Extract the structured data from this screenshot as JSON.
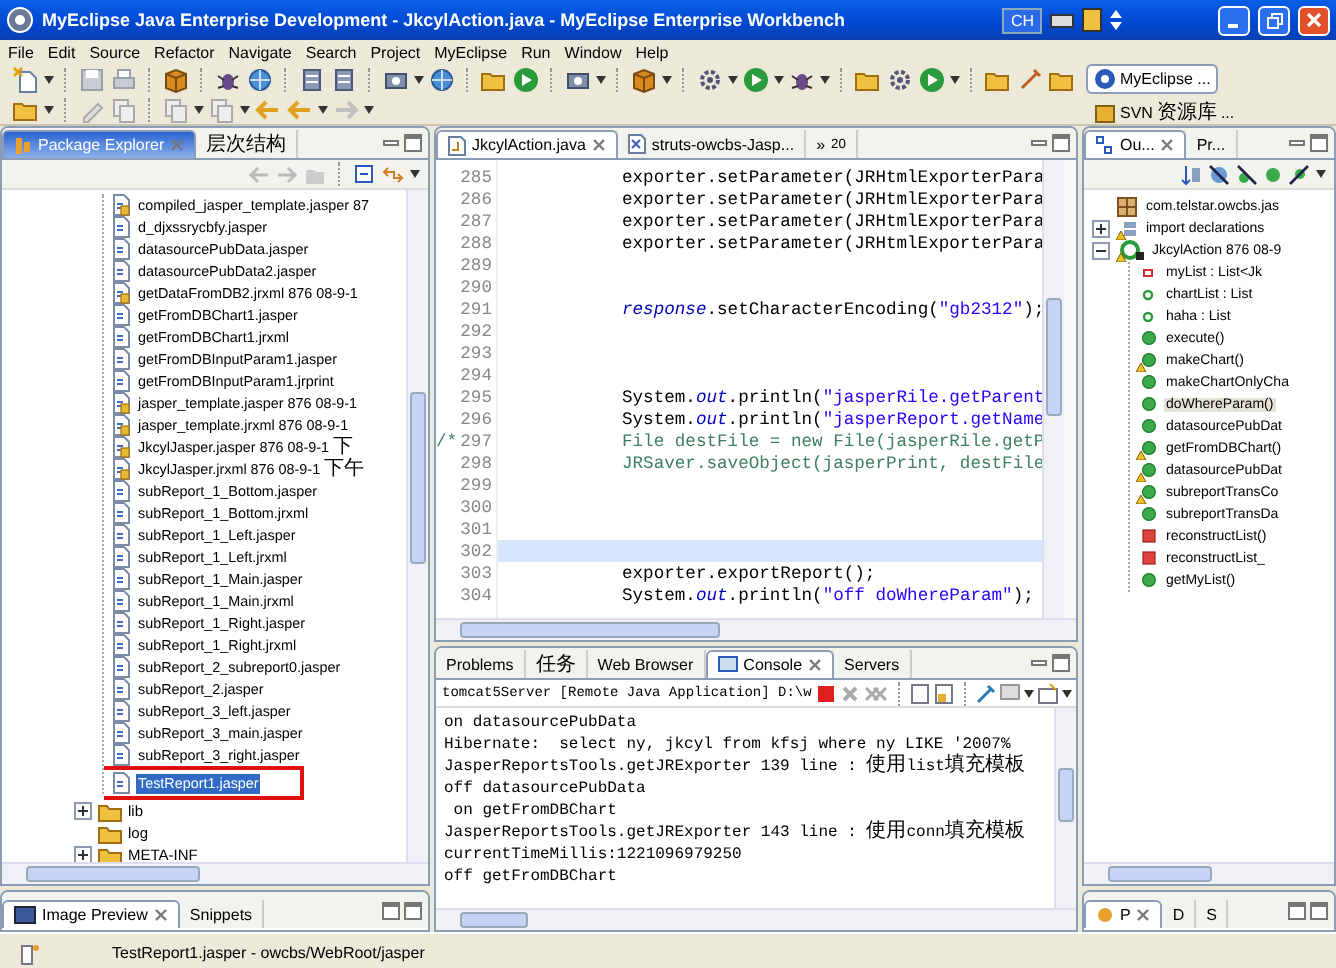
{
  "window": {
    "title": "MyEclipse Java Enterprise Development - JkcylAction.java - MyEclipse Enterprise Workbench",
    "language": "CH"
  },
  "menu": [
    "File",
    "Edit",
    "Source",
    "Refactor",
    "Navigate",
    "Search",
    "Project",
    "MyEclipse",
    "Run",
    "Window",
    "Help"
  ],
  "perspectives": [
    {
      "label": "MyEclipse ...",
      "selected": true
    },
    {
      "label": "SVN 资源库...",
      "selected": false
    }
  ],
  "explorer": {
    "tabs": [
      {
        "label": "Package Explorer",
        "selected": true
      },
      {
        "label": "层次结构",
        "selected": false
      }
    ],
    "files": [
      {
        "name": "compiled_jasper_template.jasper 87",
        "locked": true,
        "selected": false
      },
      {
        "name": "d_djxssrycbfy.jasper",
        "locked": false,
        "selected": false
      },
      {
        "name": "datasourcePubData.jasper",
        "locked": false,
        "selected": false
      },
      {
        "name": "datasourcePubData2.jasper",
        "locked": false,
        "selected": false
      },
      {
        "name": "getDataFromDB2.jrxml 876  08-9-1",
        "locked": true,
        "selected": false
      },
      {
        "name": "getFromDBChart1.jasper",
        "locked": false,
        "selected": false
      },
      {
        "name": "getFromDBChart1.jrxml",
        "locked": false,
        "selected": false
      },
      {
        "name": "getFromDBInputParam1.jasper",
        "locked": false,
        "selected": false
      },
      {
        "name": "getFromDBInputParam1.jrprint",
        "locked": false,
        "selected": false
      },
      {
        "name": "jasper_template.jasper 876  08-9-1",
        "locked": true,
        "selected": false
      },
      {
        "name": "jasper_template.jrxml 876  08-9-1",
        "locked": true,
        "selected": false
      },
      {
        "name": "JkcylJasper.jasper 876  08-9-1 下",
        "locked": true,
        "selected": false
      },
      {
        "name": "JkcylJasper.jrxml 876  08-9-1 下午",
        "locked": true,
        "selected": false
      },
      {
        "name": "subReport_1_Bottom.jasper",
        "locked": false,
        "selected": false
      },
      {
        "name": "subReport_1_Bottom.jrxml",
        "locked": false,
        "selected": false
      },
      {
        "name": "subReport_1_Left.jasper",
        "locked": false,
        "selected": false
      },
      {
        "name": "subReport_1_Left.jrxml",
        "locked": false,
        "selected": false
      },
      {
        "name": "subReport_1_Main.jasper",
        "locked": false,
        "selected": false
      },
      {
        "name": "subReport_1_Main.jrxml",
        "locked": false,
        "selected": false
      },
      {
        "name": "subReport_1_Right.jasper",
        "locked": false,
        "selected": false
      },
      {
        "name": "subReport_1_Right.jrxml",
        "locked": false,
        "selected": false
      },
      {
        "name": "subReport_2_subreport0.jasper",
        "locked": false,
        "selected": false
      },
      {
        "name": "subReport_2.jasper",
        "locked": false,
        "selected": false
      },
      {
        "name": "subReport_3_left.jasper",
        "locked": false,
        "selected": false
      },
      {
        "name": "subReport_3_main.jasper",
        "locked": false,
        "selected": false
      },
      {
        "name": "subReport_3_right.jasper",
        "locked": false,
        "selected": false
      },
      {
        "name": "TestReport1.jasper",
        "locked": false,
        "selected": true
      }
    ],
    "folders": [
      {
        "name": "lib",
        "expandable": true
      },
      {
        "name": "log",
        "expandable": false
      },
      {
        "name": "META-INF",
        "expandable": true
      }
    ]
  },
  "bottom_left_tabs": [
    {
      "label": "Image Preview",
      "selected": true
    },
    {
      "label": "Snippets",
      "selected": false
    }
  ],
  "editor": {
    "tabs": [
      {
        "label": "JkcylAction.java",
        "selected": true
      },
      {
        "label": "struts-owcbs-Jasp...",
        "selected": false
      }
    ],
    "overflow": {
      "chevron": "»",
      "count": "20"
    },
    "lines": [
      {
        "number": "285",
        "current": false,
        "segments": [
          {
            "text": "exporter.setParameter(JRHtmlExporterPara",
            "kind": "plain"
          }
        ]
      },
      {
        "number": "286",
        "current": false,
        "segments": [
          {
            "text": "exporter.setParameter(JRHtmlExporterPara",
            "kind": "plain"
          }
        ]
      },
      {
        "number": "287",
        "current": false,
        "segments": [
          {
            "text": "exporter.setParameter(JRHtmlExporterPara",
            "kind": "plain"
          }
        ]
      },
      {
        "number": "288",
        "current": false,
        "segments": [
          {
            "text": "exporter.setParameter(JRHtmlExporterPara",
            "kind": "plain"
          }
        ]
      },
      {
        "number": "289",
        "current": false
      },
      {
        "number": "290",
        "current": false
      },
      {
        "number": "291",
        "current": false,
        "segments": [
          {
            "text": "response",
            "kind": "field"
          },
          {
            "text": ".setCharacterEncoding(",
            "kind": "plain"
          },
          {
            "text": "\"gb2312\"",
            "kind": "string"
          },
          {
            "text": ");",
            "kind": "plain"
          }
        ]
      },
      {
        "number": "292",
        "current": false
      },
      {
        "number": "293",
        "current": false
      },
      {
        "number": "294",
        "current": false
      },
      {
        "number": "295",
        "current": false,
        "segments": [
          {
            "text": "System.",
            "kind": "plain"
          },
          {
            "text": "out",
            "kind": "field"
          },
          {
            "text": ".println(",
            "kind": "plain"
          },
          {
            "text": "\"jasperRile.getParent",
            "kind": "string"
          }
        ]
      },
      {
        "number": "296",
        "current": false,
        "segments": [
          {
            "text": "System.",
            "kind": "plain"
          },
          {
            "text": "out",
            "kind": "field"
          },
          {
            "text": ".println(",
            "kind": "plain"
          },
          {
            "text": "\"jasperReport.getName",
            "kind": "string"
          }
        ]
      },
      {
        "number": "297",
        "current": false,
        "gutter": "/*",
        "segments": [
          {
            "text": "File destFile = new File(jasperRile.getP",
            "kind": "comment"
          }
        ]
      },
      {
        "number": "298",
        "current": false,
        "segments": [
          {
            "text": "JRSaver.saveObject(jasperPrint, destFile",
            "kind": "comment"
          }
        ]
      },
      {
        "number": "299",
        "current": false
      },
      {
        "number": "300",
        "current": false
      },
      {
        "number": "301",
        "current": false
      },
      {
        "number": "302",
        "current": true
      },
      {
        "number": "303",
        "current": false,
        "segments": [
          {
            "text": "exporter.exportReport();",
            "kind": "plain"
          }
        ]
      },
      {
        "number": "304",
        "current": false,
        "segments": [
          {
            "text": "System.",
            "kind": "plain"
          },
          {
            "text": "out",
            "kind": "field"
          },
          {
            "text": ".println(",
            "kind": "plain"
          },
          {
            "text": "\"off doWhereParam\"",
            "kind": "string"
          },
          {
            "text": ");",
            "kind": "plain"
          }
        ]
      }
    ]
  },
  "console": {
    "tabs": [
      {
        "label": "Problems",
        "selected": false
      },
      {
        "label": "任务",
        "selected": false
      },
      {
        "label": "Web Browser",
        "selected": false
      },
      {
        "label": "Console",
        "selected": true
      },
      {
        "label": "Servers",
        "selected": false
      }
    ],
    "header": "tomcat5Server [Remote Java Application] D:\\w",
    "lines": [
      "on datasourcePubData",
      "Hibernate:  select ny, jkcyl from kfsj where ny LIKE '2007%",
      "JasperReportsTools.getJRExporter 139 line : 使用list填充模板",
      "off datasourcePubData",
      " on getFromDBChart",
      "JasperReportsTools.getJRExporter 143 line : 使用conn填充模板",
      "currentTimeMillis:1221096979250",
      "off getFromDBChart"
    ]
  },
  "outline": {
    "tabs": [
      {
        "label": "Ou...",
        "selected": true
      },
      {
        "label": "Pr...",
        "selected": false
      }
    ],
    "items": [
      {
        "label": "com.telstar.owcbs.jas",
        "kind": "package",
        "warning": false
      },
      {
        "label": "import declarations",
        "kind": "imports",
        "warning": true,
        "expanded": false
      },
      {
        "label": "JkcylAction 876  08-9",
        "kind": "class",
        "warning": true,
        "expanded": true,
        "children": [
          {
            "label": "myList : List<Jk",
            "kind": "field-private",
            "warning": false,
            "selected": false
          },
          {
            "label": "chartList : List",
            "kind": "field",
            "warning": false,
            "selected": false
          },
          {
            "label": "haha : List",
            "kind": "field",
            "warning": false,
            "selected": false
          },
          {
            "label": "execute()",
            "kind": "method",
            "warning": false,
            "selected": false
          },
          {
            "label": "makeChart()",
            "kind": "method",
            "warning": true,
            "selected": false
          },
          {
            "label": "makeChartOnlyCha",
            "kind": "method",
            "warning": false,
            "selected": false
          },
          {
            "label": "doWhereParam()",
            "kind": "method",
            "warning": false,
            "selected": true
          },
          {
            "label": "datasourcePubDat",
            "kind": "method",
            "warning": false,
            "selected": false
          },
          {
            "label": "getFromDBChart()",
            "kind": "method",
            "warning": true,
            "selected": false
          },
          {
            "label": "datasourcePubDat",
            "kind": "method",
            "warning": true,
            "selected": false
          },
          {
            "label": "subreportTransCo",
            "kind": "method",
            "warning": true,
            "selected": false
          },
          {
            "label": "subreportTransDa",
            "kind": "method",
            "warning": false,
            "selected": false
          },
          {
            "label": "reconstructList()",
            "kind": "method-private",
            "warning": false,
            "selected": false
          },
          {
            "label": "reconstructList_",
            "kind": "method-private",
            "warning": false,
            "selected": false
          },
          {
            "label": "getMyList()",
            "kind": "method",
            "warning": false,
            "selected": false
          }
        ]
      }
    ]
  },
  "bottom_right_tabs": [
    {
      "label": "P",
      "selected": true
    },
    {
      "label": "D",
      "selected": false
    },
    {
      "label": "S",
      "selected": false
    }
  ],
  "status_bar": {
    "text": "TestReport1.jasper - owcbs/WebRoot/jasper"
  }
}
